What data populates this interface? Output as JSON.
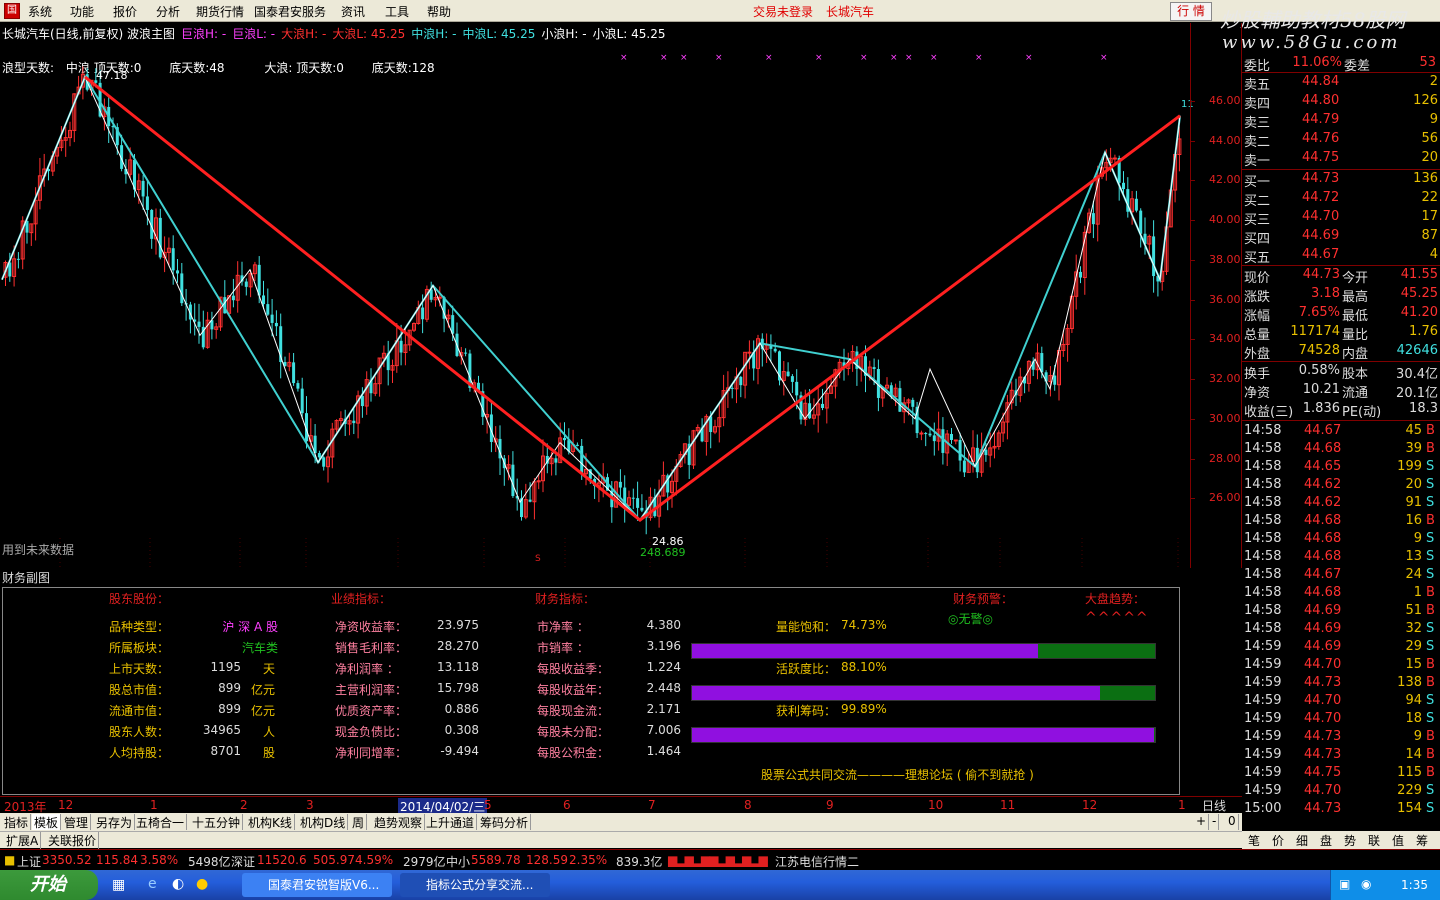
{
  "menu": {
    "items": [
      "系统",
      "功能",
      "报价",
      "分析",
      "期货行情",
      "国泰君安服务",
      "资讯",
      "工具",
      "帮助"
    ],
    "status_left": "交易未登录",
    "status_right": "长城汽车",
    "trade_button": "行 情"
  },
  "watermark": {
    "line1": "炒股輔助教材58股网",
    "line2": "www.58Gu.com"
  },
  "chart": {
    "header": [
      {
        "text": "长城汽车(日线,前复权) 波浪主图",
        "color": "#ffffff"
      },
      {
        "text": "巨浪H: -",
        "color": "#ff40ff"
      },
      {
        "text": "巨浪L: -",
        "color": "#ff40ff"
      },
      {
        "text": "大浪H: -",
        "color": "#ff3030"
      },
      {
        "text": "大浪L: 45.25",
        "color": "#ff3030"
      },
      {
        "text": "中浪H: -",
        "color": "#40e0e0"
      },
      {
        "text": "中浪L: 45.25",
        "color": "#40e0e0"
      },
      {
        "text": "小浪H: -",
        "color": "#ffffff"
      },
      {
        "text": "小浪L: 45.25",
        "color": "#ffffff"
      }
    ],
    "line2": {
      "a": "浪型天数:",
      "b": "中浪 顶天数:0",
      "c": "底天数:48",
      "d": "大浪: 顶天数:0",
      "e": "底天数:128"
    },
    "high_label": "47.18",
    "low_label": "24.86",
    "low_vol_label": "248.689",
    "future_note": "用到未来数据",
    "marker_s": "S",
    "right_edge_label": "11",
    "yticks": [
      "46.00",
      "44.00",
      "42.00",
      "40.00",
      "38.00",
      "36.00",
      "34.00",
      "32.00",
      "30.00",
      "28.00",
      "26.00"
    ],
    "y_range": [
      24.0,
      47.5
    ]
  },
  "subchart_title": "财务副图",
  "fin": {
    "h1": "股东股份：",
    "h2": "业绩指标：",
    "h3": "财务指标：",
    "h4": "财务预警：",
    "h5": "大盘趋势：",
    "warn": "◎无警◎",
    "trend": "^^^^^",
    "col1": [
      {
        "label": "品种类型：",
        "value": "沪 深 A 股",
        "unit": ""
      },
      {
        "label": "所属板块：",
        "value": "汽车类",
        "unit": ""
      },
      {
        "label": "上市天数：",
        "value": "1195",
        "unit": "天"
      },
      {
        "label": "股总市值：",
        "value": "899",
        "unit": "亿元"
      },
      {
        "label": "流通市值：",
        "value": "899",
        "unit": "亿元"
      },
      {
        "label": "股东人数：",
        "value": "34965",
        "unit": "人"
      },
      {
        "label": "人均持股：",
        "value": "8701",
        "unit": "股"
      }
    ],
    "col2": [
      {
        "label": "净资收益率：",
        "value": "23.975"
      },
      {
        "label": "销售毛利率：",
        "value": "28.270"
      },
      {
        "label": "净利润率  ：",
        "value": "13.118"
      },
      {
        "label": "主营利润率：",
        "value": "15.798"
      },
      {
        "label": "优质资产率：",
        "value": "0.886"
      },
      {
        "label": "现金负债比：",
        "value": "0.308"
      },
      {
        "label": "净利同增率：",
        "value": "-9.494"
      }
    ],
    "col3": [
      {
        "label": "市净率    ：",
        "value": "4.380"
      },
      {
        "label": "市销率    ：",
        "value": "3.196"
      },
      {
        "label": "每股收益季：",
        "value": "1.224"
      },
      {
        "label": "每股收益年：",
        "value": "2.448"
      },
      {
        "label": "每股现金流：",
        "value": "2.171"
      },
      {
        "label": "每股未分配：",
        "value": "7.006"
      },
      {
        "label": "每股公积金：",
        "value": "1.464"
      }
    ],
    "gauges": [
      {
        "label": "量能饱和：",
        "pct": "74.73%",
        "frac": 0.7473
      },
      {
        "label": "活跃度比：",
        "pct": "88.10%",
        "frac": 0.881
      },
      {
        "label": "获利筹码：",
        "pct": "99.89%",
        "frac": 0.9989
      }
    ],
    "footer": "股票公式共同交流————理想论坛 ( 偷不到就抢 )"
  },
  "dateaxis": {
    "labels": [
      "2013年",
      "12",
      "1",
      "2",
      "3",
      "2014/04/02/三",
      "5",
      "6",
      "7",
      "8",
      "9",
      "10",
      "11",
      "12",
      "1"
    ],
    "period": "日线"
  },
  "tabs": [
    "指标",
    "模板",
    "管理",
    "另存为",
    "五椅合一",
    "十五分钟",
    "机构K线",
    "机构D线",
    "周",
    "趋势观察",
    "上升通道",
    "筹码分析"
  ],
  "tabs2": [
    "扩展A",
    "关联报价"
  ],
  "tab_controls": [
    "+",
    "-",
    "0"
  ],
  "quote": {
    "top_cut": {
      "a": "委比",
      "b": "11.06%",
      "c": "委差",
      "d": "53"
    },
    "asks": [
      {
        "label": "卖五",
        "price": "44.84",
        "vol": "2"
      },
      {
        "label": "卖四",
        "price": "44.80",
        "vol": "126"
      },
      {
        "label": "卖三",
        "price": "44.79",
        "vol": "9"
      },
      {
        "label": "卖二",
        "price": "44.76",
        "vol": "56"
      },
      {
        "label": "卖一",
        "price": "44.75",
        "vol": "20"
      }
    ],
    "bids": [
      {
        "label": "买一",
        "price": "44.73",
        "vol": "136"
      },
      {
        "label": "买二",
        "price": "44.72",
        "vol": "22"
      },
      {
        "label": "买三",
        "price": "44.70",
        "vol": "17"
      },
      {
        "label": "买四",
        "price": "44.69",
        "vol": "87"
      },
      {
        "label": "买五",
        "price": "44.67",
        "vol": "4"
      }
    ],
    "stats": [
      {
        "l1": "现价",
        "v1": "44.73",
        "l2": "今开",
        "v2": "41.55"
      },
      {
        "l1": "涨跌",
        "v1": "3.18",
        "l2": "最高",
        "v2": "45.25"
      },
      {
        "l1": "涨幅",
        "v1": "7.65%",
        "l2": "最低",
        "v2": "41.20"
      },
      {
        "l1": "总量",
        "v1": "117174",
        "l2": "量比",
        "v2": "1.76"
      },
      {
        "l1": "外盘",
        "v1": "74528",
        "l2": "内盘",
        "v2": "42646"
      }
    ],
    "stats2": [
      {
        "l1": "换手",
        "v1": "0.58%",
        "l2": "股本",
        "v2": "30.4亿"
      },
      {
        "l1": "净资",
        "v1": "10.21",
        "l2": "流通",
        "v2": "20.1亿"
      },
      {
        "l1": "收益(三)",
        "v1": "1.836",
        "l2": "PE(动)",
        "v2": "18.3"
      }
    ],
    "ticks": [
      {
        "t": "14:58",
        "p": "44.67",
        "v": "45",
        "s": "B"
      },
      {
        "t": "14:58",
        "p": "44.68",
        "v": "39",
        "s": "B"
      },
      {
        "t": "14:58",
        "p": "44.65",
        "v": "199",
        "s": "S"
      },
      {
        "t": "14:58",
        "p": "44.62",
        "v": "20",
        "s": "S"
      },
      {
        "t": "14:58",
        "p": "44.62",
        "v": "91",
        "s": "S"
      },
      {
        "t": "14:58",
        "p": "44.68",
        "v": "16",
        "s": "B"
      },
      {
        "t": "14:58",
        "p": "44.68",
        "v": "9",
        "s": "S"
      },
      {
        "t": "14:58",
        "p": "44.68",
        "v": "13",
        "s": "S"
      },
      {
        "t": "14:58",
        "p": "44.67",
        "v": "24",
        "s": "S"
      },
      {
        "t": "14:58",
        "p": "44.68",
        "v": "1",
        "s": "B"
      },
      {
        "t": "14:58",
        "p": "44.69",
        "v": "51",
        "s": "B"
      },
      {
        "t": "14:58",
        "p": "44.69",
        "v": "32",
        "s": "S"
      },
      {
        "t": "14:59",
        "p": "44.69",
        "v": "29",
        "s": "S"
      },
      {
        "t": "14:59",
        "p": "44.70",
        "v": "15",
        "s": "B"
      },
      {
        "t": "14:59",
        "p": "44.73",
        "v": "138",
        "s": "B"
      },
      {
        "t": "14:59",
        "p": "44.70",
        "v": "94",
        "s": "S"
      },
      {
        "t": "14:59",
        "p": "44.70",
        "v": "18",
        "s": "S"
      },
      {
        "t": "14:59",
        "p": "44.73",
        "v": "9",
        "s": "B"
      },
      {
        "t": "14:59",
        "p": "44.73",
        "v": "14",
        "s": "B"
      },
      {
        "t": "14:59",
        "p": "44.75",
        "v": "115",
        "s": "B"
      },
      {
        "t": "14:59",
        "p": "44.70",
        "v": "229",
        "s": "S"
      },
      {
        "t": "15:00",
        "p": "44.73",
        "v": "154",
        "s": "S"
      }
    ],
    "bottom_tabs": [
      "笔",
      "价",
      "细",
      "盘",
      "势",
      "联",
      "值",
      "筹"
    ]
  },
  "indexbar": {
    "sh_name": "上证",
    "sh_val": "3350.52",
    "sh_chg": "115.84",
    "sh_pct": "3.58%",
    "sh_amt": "5498亿",
    "sz_name": "深证",
    "sz_val": "11520.6",
    "sz_chg": "505.97",
    "sz_pct": "4.59%",
    "sz_amt": "2979亿",
    "zx_name": "中小",
    "zx_val": "5589.78",
    "zx_chg": "128.59",
    "zx_pct": "2.35%",
    "zx_amt": "839.3亿",
    "server": "江苏电信行情二"
  },
  "taskbar": {
    "start": "开始",
    "items": [
      "国泰君安锐智版V6...",
      "指标公式分享交流..."
    ],
    "clock": "1:35"
  }
}
